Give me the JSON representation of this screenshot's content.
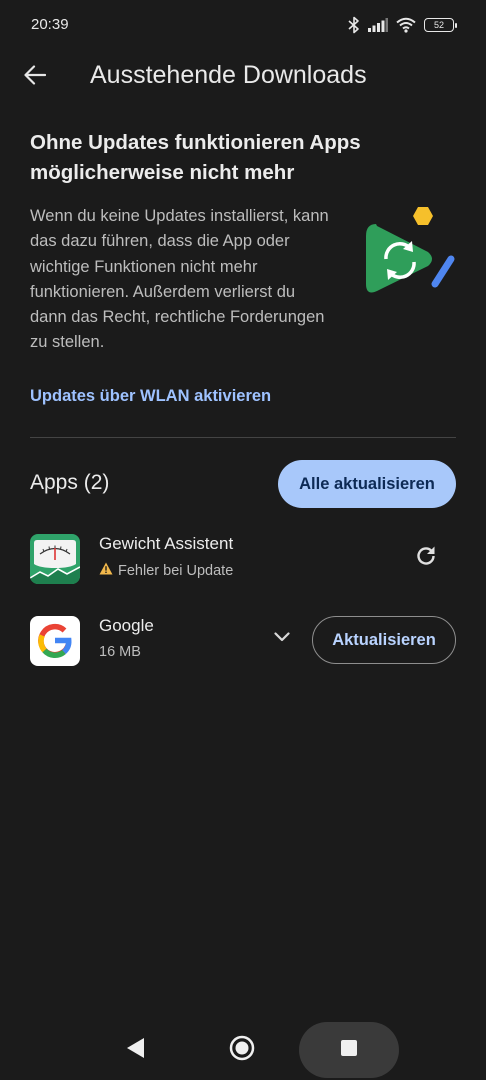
{
  "status_bar": {
    "time": "20:39",
    "battery": "52",
    "icons": [
      "bluetooth-icon",
      "signal-icon",
      "wifi-icon",
      "battery-icon"
    ]
  },
  "app_bar": {
    "title": "Ausstehende Downloads",
    "back_icon": "arrow-left-icon"
  },
  "warning": {
    "title": "Ohne Updates funktionieren Apps möglicherweise nicht mehr",
    "body": "Wenn du keine Updates installierst, kann das dazu führen, dass die App oder wichtige Funktionen nicht mehr funktionieren. Außerdem verlierst du dann das Recht, rechtliche Forderungen zu stellen.",
    "illustration_icon": "play-store-update-icon",
    "link": "Updates über WLAN aktivieren"
  },
  "apps_section": {
    "heading": "Apps (2)",
    "update_all_label": "Alle aktualisieren",
    "items": [
      {
        "name": "Gewicht Assistent",
        "status": "Fehler bei Update",
        "status_icon": "warning-icon",
        "action_icon": "refresh-icon"
      },
      {
        "name": "Google",
        "size": "16 MB",
        "expand_icon": "chevron-down-icon",
        "action_label": "Aktualisieren"
      }
    ]
  },
  "nav_bar": {
    "icons": [
      "nav-back-icon",
      "nav-home-icon",
      "nav-recents-icon"
    ]
  },
  "colors": {
    "background": "#1b1b1b",
    "accent": "#a8c8fa",
    "link": "#9ec2ff",
    "warning": "#f2b84b"
  }
}
